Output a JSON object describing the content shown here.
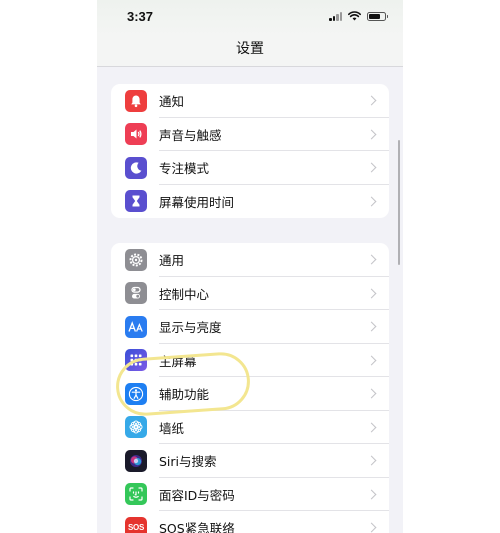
{
  "status": {
    "time": "3:37"
  },
  "nav": {
    "title": "设置"
  },
  "group1": [
    {
      "label": "通知",
      "icon": "bell-icon",
      "color": "#ee3e3e"
    },
    {
      "label": "声音与触感",
      "icon": "speaker-icon",
      "color": "#ee3e55"
    },
    {
      "label": "专注模式",
      "icon": "moon-icon",
      "color": "#5a4fcf"
    },
    {
      "label": "屏幕使用时间",
      "icon": "hourglass-icon",
      "color": "#5a4fcf"
    }
  ],
  "group2": [
    {
      "label": "通用",
      "icon": "gear-icon",
      "color": "#8e8e93"
    },
    {
      "label": "控制中心",
      "icon": "toggles-icon",
      "color": "#8e8e93"
    },
    {
      "label": "显示与亮度",
      "icon": "text-size-icon",
      "color": "#2a7cf0"
    },
    {
      "label": "主屏幕",
      "icon": "home-grid-icon",
      "color": "#3a4fd8"
    },
    {
      "label": "辅助功能",
      "icon": "accessibility-icon",
      "color": "#1e7ff2"
    },
    {
      "label": "墙纸",
      "icon": "flower-icon",
      "color": "#36a9e8"
    },
    {
      "label": "Siri与搜索",
      "icon": "siri-icon",
      "color": "#1a1a2a"
    },
    {
      "label": "面容ID与密码",
      "icon": "face-id-icon",
      "color": "#34c759"
    },
    {
      "label": "SOS紧急联络",
      "icon": "sos-icon",
      "color": "#e5342e"
    }
  ]
}
